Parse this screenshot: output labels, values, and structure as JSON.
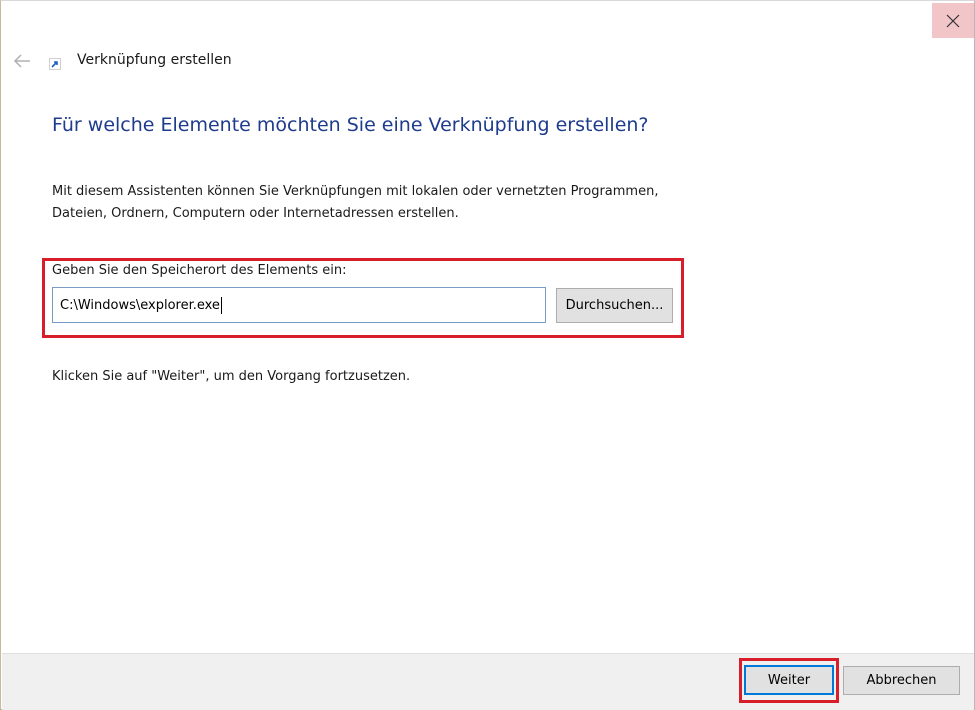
{
  "window": {
    "close_icon": "close-icon",
    "back_icon": "arrow-left-icon",
    "title": "Verknüpfung erstellen"
  },
  "main": {
    "heading": "Für welche Elemente möchten Sie eine Verknüpfung erstellen?",
    "description_line1": "Mit diesem Assistenten können Sie Verknüpfungen mit lokalen oder vernetzten Programmen,",
    "description_line2": "Dateien, Ordnern, Computern oder Internetadressen erstellen.",
    "location_label": "Geben Sie den Speicherort des Elements ein:",
    "location_value": "C:\\Windows\\explorer.exe",
    "browse_label": "Durchsuchen...",
    "continue_hint": "Klicken Sie auf \"Weiter\", um den Vorgang fortzusetzen."
  },
  "footer": {
    "next_label": "Weiter",
    "cancel_label": "Abbrechen"
  },
  "colors": {
    "heading": "#1e3c8c",
    "highlight": "#d81d2b",
    "close_hover": "#f2c6c9",
    "focus": "#0078d7"
  }
}
